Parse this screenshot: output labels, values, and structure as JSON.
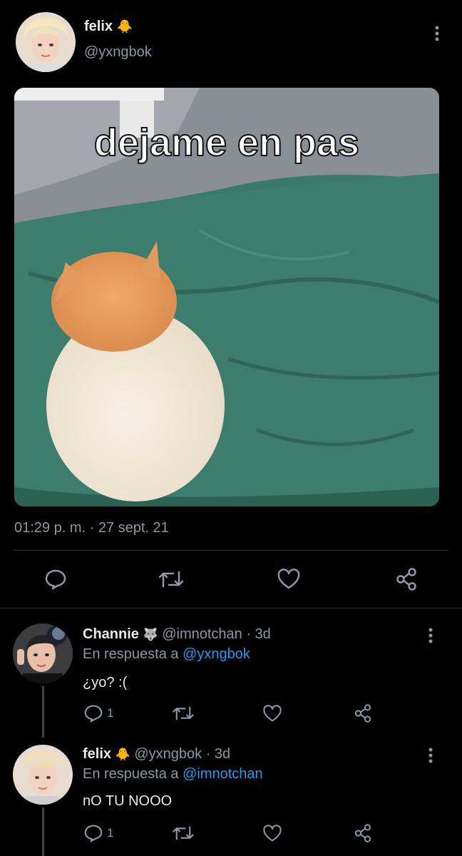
{
  "main_tweet": {
    "author": {
      "name": "felix",
      "emoji": "🐥",
      "handle": "@yxngbok"
    },
    "image_caption": "dejame en pas",
    "timestamp": "01:29 p. m. · 27 sept. 21"
  },
  "replies": [
    {
      "author": {
        "name": "Channie",
        "emoji": "🐺",
        "handle": "@imnotchan",
        "age": "· 3d"
      },
      "reply_prefix": "En respuesta a",
      "reply_to": "@yxngbok",
      "text": "¿yo? :(",
      "reply_count": "1"
    },
    {
      "author": {
        "name": "felix",
        "emoji": "🐥",
        "handle": "@yxngbok",
        "age": "· 3d"
      },
      "reply_prefix": "En respuesta a",
      "reply_to": "@imnotchan",
      "text": "nO TU NOOO",
      "reply_count": "1"
    }
  ],
  "icons": {
    "reply": "reply-icon",
    "retweet": "retweet-icon",
    "like": "heart-icon",
    "share": "share-icon",
    "more": "more-vertical-icon"
  },
  "colors": {
    "background": "#000000",
    "text": "#e7e9ea",
    "muted": "#8b98a5",
    "link": "#1d9bf0"
  }
}
